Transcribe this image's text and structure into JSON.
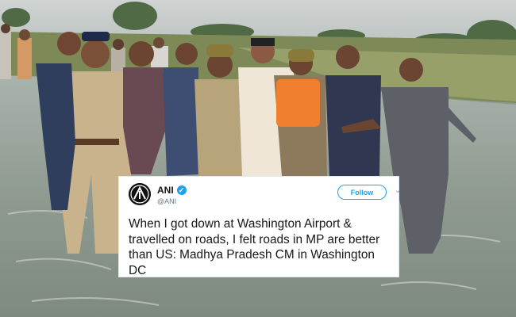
{
  "tweet": {
    "name": "ANI",
    "handle": "@ANI",
    "follow_label": "Follow",
    "text": "When I got down at Washington Airport & travelled on roads, I felt roads in MP are better than US: Madhya Pradesh CM in Washington DC",
    "avatar_icon": "ani-logo-icon",
    "verified_icon": "verified-badge-icon",
    "menu_icon": "chevron-down-icon"
  },
  "colors": {
    "accent": "#1da1f2",
    "text": "#14171a",
    "muted": "#657786"
  }
}
